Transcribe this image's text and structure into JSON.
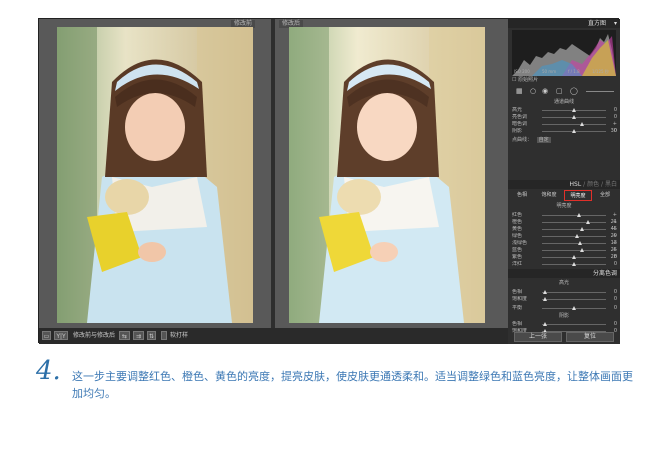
{
  "viewer": {
    "left_label": "修改前",
    "right_label": "修改后"
  },
  "toolbar": {
    "mode_label": "Y|Y",
    "view_label": "修改前与修改后",
    "softproof_label": "软打样"
  },
  "panel": {
    "histogram_title": "直方图",
    "histogram_info": [
      "ISO 200",
      "50 mm",
      "f / 1.8",
      "1/125 秒"
    ],
    "original_photo_label": "原始照片",
    "tone_curve": {
      "title": "通道曲线",
      "rows": [
        {
          "label": "高光",
          "value": "0",
          "pos": 0.5
        },
        {
          "label": "亮色调",
          "value": "0",
          "pos": 0.5
        },
        {
          "label": "暗色调",
          "value": "+ 30",
          "pos": 0.62
        },
        {
          "label": "阴影",
          "value": "0",
          "pos": 0.5
        }
      ],
      "channel_label": "点曲线：",
      "channel_value": "自定"
    },
    "hsl": {
      "header": "HSL",
      "header_sep": "/",
      "header_color": "颜色",
      "header_bw": "黑白",
      "tabs": [
        "色相",
        "饱和度",
        "明亮度",
        "全部"
      ],
      "active_tab": 2,
      "section_title": "明亮度",
      "rows": [
        {
          "label": "红色",
          "value": "+ 21",
          "pos": 0.58
        },
        {
          "label": "橙色",
          "value": "+ 45",
          "pos": 0.72
        },
        {
          "label": "黄色",
          "value": "+ 29",
          "pos": 0.62
        },
        {
          "label": "绿色",
          "value": "+ 13",
          "pos": 0.55
        },
        {
          "label": "浅绿色",
          "value": "+ 25",
          "pos": 0.6
        },
        {
          "label": "蓝色",
          "value": "+ 28",
          "pos": 0.62
        },
        {
          "label": "紫色",
          "value": "0",
          "pos": 0.5
        },
        {
          "label": "洋红",
          "value": "0",
          "pos": 0.5
        }
      ]
    },
    "split_toning": {
      "title": "分离色调",
      "highlights_title": "高光",
      "hl_rows": [
        {
          "label": "色相",
          "value": "0",
          "pos": 0.05
        },
        {
          "label": "饱和度",
          "value": "0",
          "pos": 0.05
        }
      ],
      "balance_label": "平衡",
      "balance_value": "0",
      "shadows_title": "阴影",
      "sh_rows": [
        {
          "label": "色相",
          "value": "0",
          "pos": 0.05
        },
        {
          "label": "饱和度",
          "value": "0",
          "pos": 0.05
        }
      ]
    },
    "prev_button": "上一张",
    "reset_button": "复位"
  },
  "caption": {
    "step_number": "4.",
    "text": "这一步主要调整红色、橙色、黄色的亮度，提亮皮肤，使皮肤更通透柔和。适当调整绿色和蓝色亮度，让整体画面更加均匀。"
  },
  "colors": {
    "caption": "#3c78b4",
    "active_tab_border": "#e0302a"
  }
}
